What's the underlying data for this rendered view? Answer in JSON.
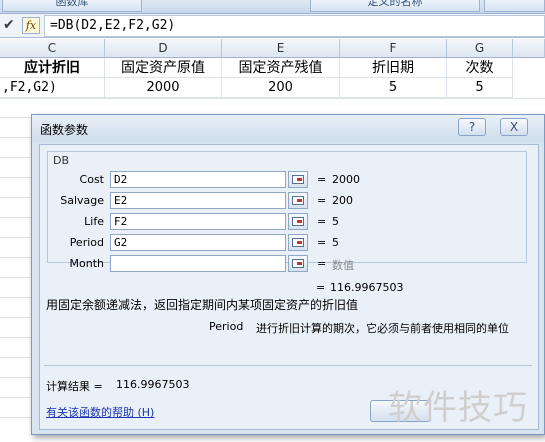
{
  "ribbon": {
    "left_label": "函数库",
    "right_label": "定义的名称"
  },
  "formula_bar": {
    "confirm_glyph": "✔",
    "fx_label": "fx",
    "formula": "=DB(D2,E2,F2,G2)"
  },
  "sheet": {
    "columns": [
      "C",
      "D",
      "E",
      "F",
      "G"
    ],
    "header_row": [
      "应计折旧",
      "固定资产原值",
      "固定资产残值",
      "折旧期",
      "次数"
    ],
    "data_row": [
      ",F2,G2)",
      "2000",
      "200",
      "5",
      "5"
    ]
  },
  "dialog": {
    "title": "函数参数",
    "help_btn": "?",
    "close_btn": "X",
    "function_name": "DB",
    "args": [
      {
        "label": "Cost",
        "value": "D2",
        "result": "2000"
      },
      {
        "label": "Salvage",
        "value": "E2",
        "result": "200"
      },
      {
        "label": "Life",
        "value": "F2",
        "result": "5"
      },
      {
        "label": "Period",
        "value": "G2",
        "result": "5"
      },
      {
        "label": "Month",
        "value": "",
        "result": "数值"
      }
    ],
    "eq": "=",
    "func_result": "116.9967503",
    "description": "用固定余额递减法，返回指定期间内某项固定资产的折旧值",
    "arg_help_name": "Period",
    "arg_help_text": "进行折旧计算的期次，它必须与前者使用相同的单位",
    "calc_label": "计算结果 =",
    "calc_value": "116.9967503",
    "help_link": "有关该函数的帮助 (H)"
  },
  "watermark": "软件技巧"
}
